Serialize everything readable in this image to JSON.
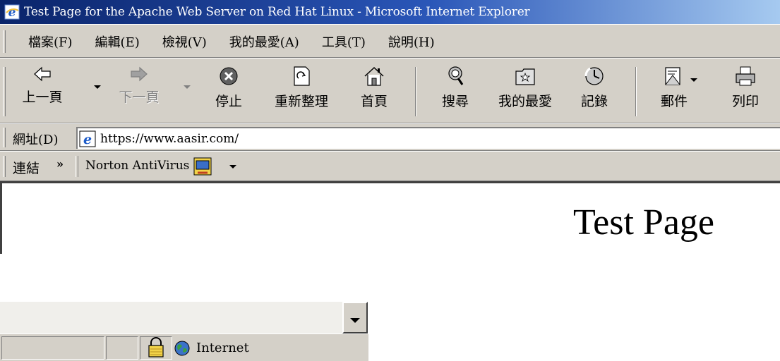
{
  "window": {
    "title": "Test Page for the Apache Web Server on Red Hat Linux - Microsoft Internet Explorer"
  },
  "menu": {
    "items": [
      "檔案(F)",
      "編輯(E)",
      "檢視(V)",
      "我的最愛(A)",
      "工具(T)",
      "說明(H)"
    ]
  },
  "toolbar": {
    "buttons": [
      {
        "label": "上一頁",
        "icon": "back-arrow-icon",
        "enabled": true
      },
      {
        "label": "下一頁",
        "icon": "forward-arrow-icon",
        "enabled": false
      },
      {
        "label": "停止",
        "icon": "stop-icon",
        "enabled": true
      },
      {
        "label": "重新整理",
        "icon": "refresh-icon",
        "enabled": true
      },
      {
        "label": "首頁",
        "icon": "home-icon",
        "enabled": true
      },
      {
        "label": "搜尋",
        "icon": "search-icon",
        "enabled": true
      },
      {
        "label": "我的最愛",
        "icon": "favorites-icon",
        "enabled": true
      },
      {
        "label": "記錄",
        "icon": "history-icon",
        "enabled": true
      },
      {
        "label": "郵件",
        "icon": "mail-icon",
        "enabled": true
      },
      {
        "label": "列印",
        "icon": "print-icon",
        "enabled": true
      }
    ]
  },
  "address": {
    "label": "網址(D)",
    "url": "https://www.aasir.com/"
  },
  "links": {
    "label": "連結",
    "chevron": "»",
    "norton": "Norton AntiVirus"
  },
  "content": {
    "heading": "Test Page"
  },
  "status": {
    "zone": "Internet"
  },
  "colors": {
    "titlebar_start": "#0a246a",
    "titlebar_end": "#a6caf0",
    "chrome": "#d4d0c8"
  }
}
